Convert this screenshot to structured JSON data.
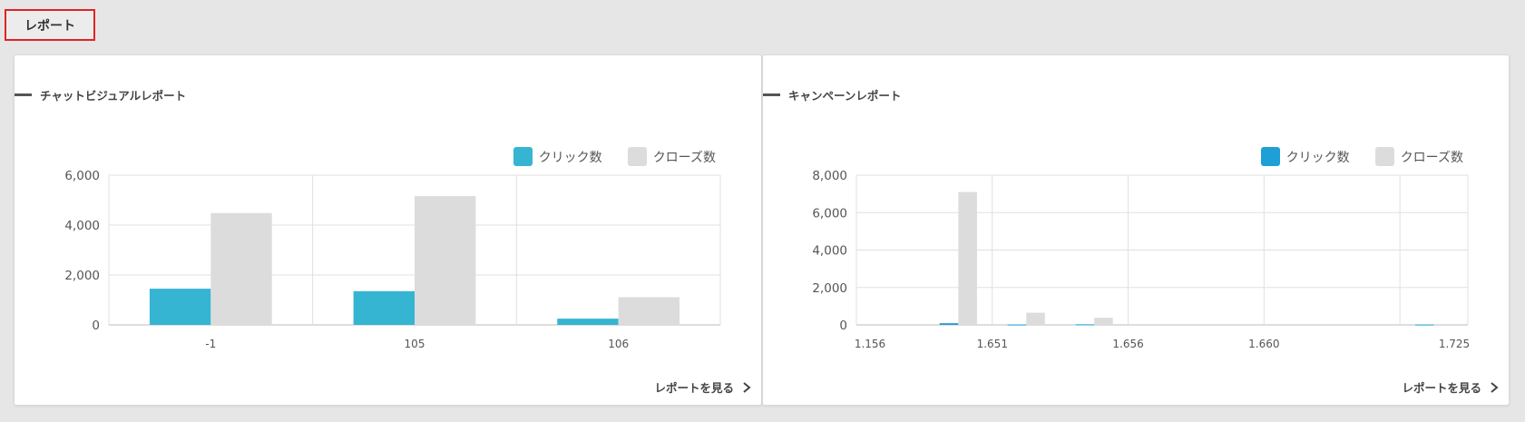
{
  "tab": {
    "label": "レポート"
  },
  "panels": [
    {
      "title": "チャットビジュアルレポート",
      "link_label": "レポートを見る",
      "legend": [
        {
          "label": "クリック数",
          "color": "#35b5d2"
        },
        {
          "label": "クローズ数",
          "color": "#dcdcdc"
        }
      ]
    },
    {
      "title": "キャンペーンレポート",
      "link_label": "レポートを見る",
      "legend": [
        {
          "label": "クリック数",
          "color": "#1e9fd6"
        },
        {
          "label": "クローズ数",
          "color": "#dcdcdc"
        }
      ]
    }
  ],
  "chart_data": [
    {
      "type": "bar",
      "categories": [
        "-1",
        "105",
        "106"
      ],
      "series": [
        {
          "name": "クリック数",
          "values": [
            1450,
            1350,
            250
          ]
        },
        {
          "name": "クローズ数",
          "values": [
            4480,
            5160,
            1110
          ]
        }
      ],
      "ylim": [
        0,
        6000
      ],
      "yticks": [
        "0",
        "2,000",
        "4,000",
        "6,000"
      ],
      "grid": true,
      "legend_position": "top-right"
    },
    {
      "type": "bar",
      "categories": [
        "1.156",
        "",
        "1.651",
        "",
        "1.656",
        "",
        "1.660",
        "",
        "1.725"
      ],
      "series": [
        {
          "name": "クリック数",
          "values": [
            0,
            90,
            20,
            30,
            0,
            0,
            0,
            0,
            20
          ]
        },
        {
          "name": "クローズ数",
          "values": [
            0,
            7100,
            650,
            380,
            0,
            0,
            0,
            0,
            0
          ]
        }
      ],
      "ylim": [
        0,
        8000
      ],
      "yticks": [
        "0",
        "2,000",
        "4,000",
        "6,000",
        "8,000"
      ],
      "grid": true,
      "legend_position": "top-right"
    }
  ]
}
